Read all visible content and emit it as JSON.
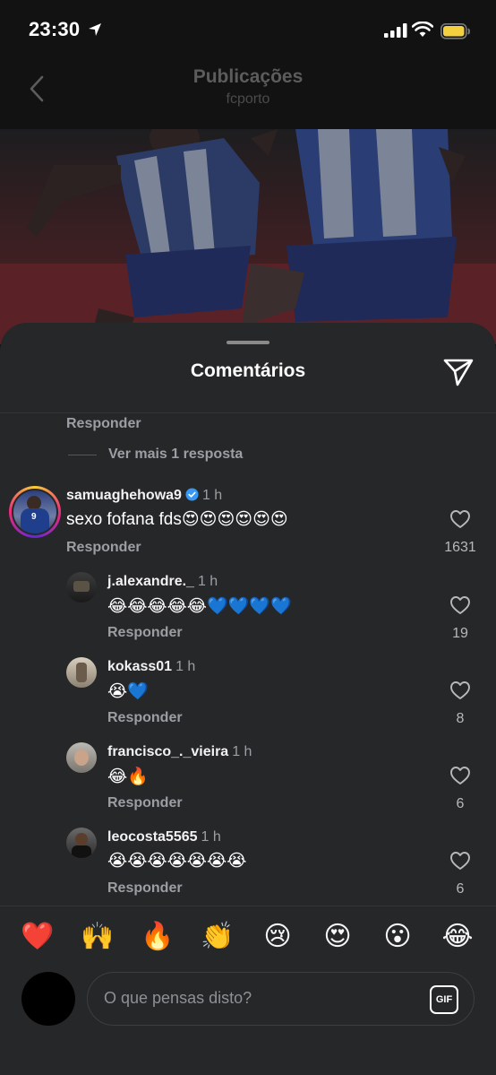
{
  "status": {
    "time": "23:30"
  },
  "header": {
    "title": "Publicações",
    "subtitle": "fcporto"
  },
  "sheet": {
    "title": "Comentários",
    "top_reply_label": "Responder",
    "more_replies": "Ver mais 1 resposta"
  },
  "comments": [
    {
      "user": "samuaghehowa9",
      "verified": true,
      "time": "1 h",
      "text": "sexo fofana fds😍😍😍😍😍😍",
      "reply": "Responder",
      "likes": "1631"
    },
    {
      "user": "j.alexandre._",
      "time": "1 h",
      "text": "😂😂😂😂😂💙💙💙💙",
      "reply": "Responder",
      "likes": "19"
    },
    {
      "user": "kokass01",
      "time": "1 h",
      "text": "😭💙",
      "reply": "Responder",
      "likes": "8"
    },
    {
      "user": "francisco_._vieira",
      "time": "1 h",
      "text": "😂🔥",
      "reply": "Responder",
      "likes": "6"
    },
    {
      "user": "leocosta5565",
      "time": "1 h",
      "text": "😭😭😭😭😭😭😭",
      "reply": "Responder",
      "likes": "6"
    }
  ],
  "reactions": [
    "❤️",
    "🙌",
    "🔥",
    "👏",
    "😢",
    "😍",
    "😮",
    "😂"
  ],
  "input": {
    "placeholder": "O que pensas disto?",
    "gif_label": "GIF"
  },
  "colors": {
    "sheet_bg": "#262729",
    "accent_blue": "#3897f0",
    "muted_text": "#9c9ea3"
  }
}
